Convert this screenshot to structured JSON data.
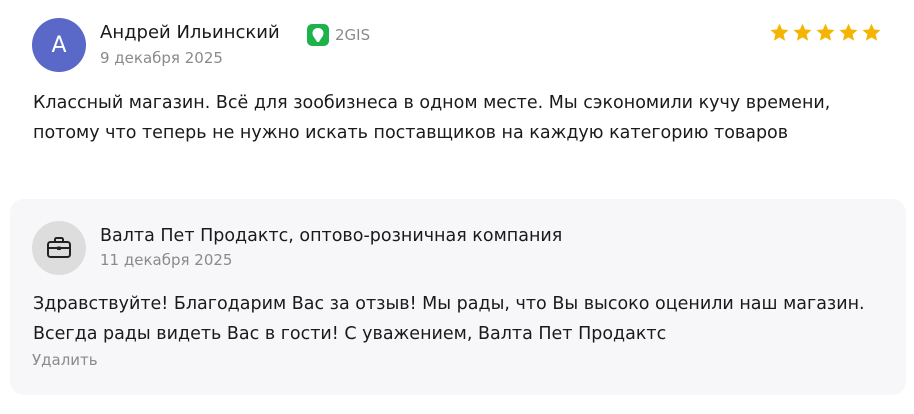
{
  "review": {
    "avatar_letter": "А",
    "avatar_color": "#5a68c8",
    "author_name": "Андрей Ильинский",
    "source": {
      "icon": "2gis-icon",
      "label": "2GIS",
      "color": "#1bb34a"
    },
    "date": "9 декабря 2025",
    "rating": {
      "value": 5,
      "max": 5,
      "star_color": "#f5b400"
    },
    "text": "Классный магазин. Всё для зообизнеса в одном месте. Мы сэкономили кучу времени, потому что теперь не нужно искать поставщиков на каждую категорию товаров"
  },
  "reply": {
    "avatar_icon": "briefcase-icon",
    "company_name": "Валта Пет Продактс, оптово-розничная компания",
    "date": "11 декабря 2025",
    "text": "Здравствуйте! Благодарим Вас за отзыв! Мы рады, что Вы высоко оценили наш магазин. Всегда рады видеть Вас в гости! С уважением, Валта Пет Продактс",
    "delete_label": "Удалить"
  }
}
